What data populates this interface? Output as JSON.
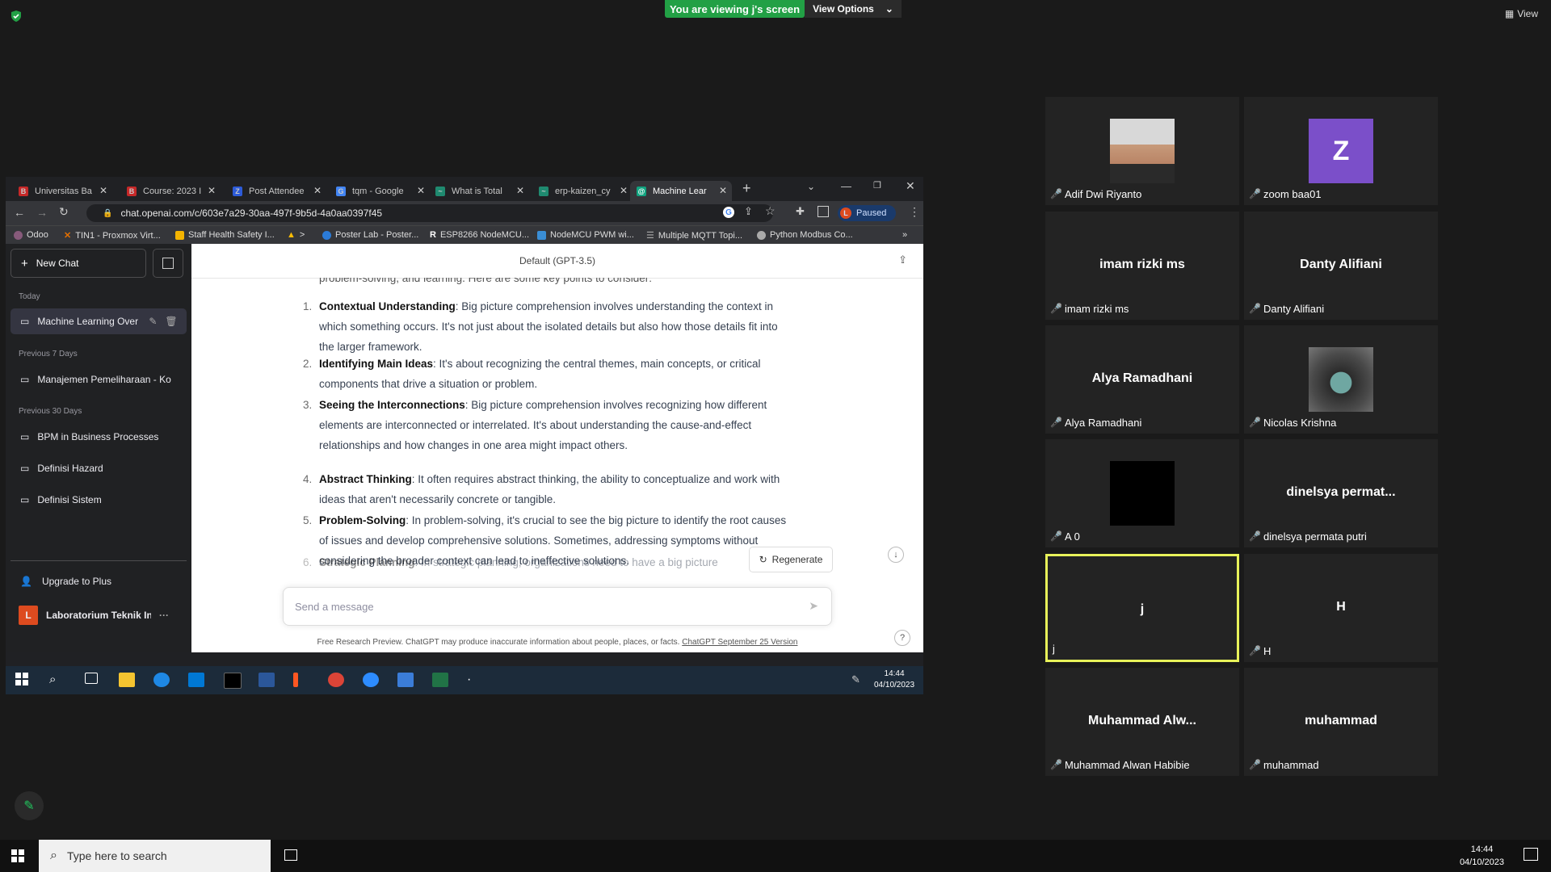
{
  "zoom": {
    "share_banner": "You are viewing j's screen",
    "view_options": "View Options",
    "view_label": "View"
  },
  "browser": {
    "tabs": [
      {
        "label": "Universitas Ba",
        "color": "#c62828",
        "icon": "B"
      },
      {
        "label": "Course: 2023 I",
        "color": "#c62828",
        "icon": "B"
      },
      {
        "label": "Post Attendee",
        "color": "#2d5bd8",
        "icon": "Z"
      },
      {
        "label": "tqm - Google",
        "color": "#4285f4",
        "icon": "G"
      },
      {
        "label": "What is Total",
        "color": "#1f8a70",
        "icon": "~"
      },
      {
        "label": "erp-kaizen_cy",
        "color": "#1f8a70",
        "icon": "~"
      },
      {
        "label": "Machine Lear",
        "color": "#10a37f",
        "icon": "@"
      }
    ],
    "url": "chat.openai.com/c/603e7a29-30aa-497f-9b5d-4a0aa0397f45",
    "profile_status": "Paused",
    "profile_initial": "L",
    "bookmarks": [
      "Odoo",
      "TIN1 - Proxmox Virt...",
      "Staff Health Safety I...",
      ">",
      "Poster Lab - Poster...",
      "ESP8266 NodeMCU...",
      "NodeMCU PWM wi...",
      "Multiple MQTT Topi...",
      "Python Modbus Co..."
    ]
  },
  "gpt": {
    "new_chat": "New Chat",
    "sections": {
      "today": "Today",
      "prev7": "Previous 7 Days",
      "prev30": "Previous 30 Days"
    },
    "history": {
      "today": [
        "Machine Learning Over"
      ],
      "prev7": [
        "Manajemen Pemeliharaan - Ko"
      ],
      "prev30": [
        "BPM in Business Processes",
        "Definisi Hazard",
        "Definisi Sistem"
      ]
    },
    "upgrade": "Upgrade to Plus",
    "user_name": "Laboratorium Teknik In",
    "user_initial": "L",
    "model": "Default (GPT-3.5)",
    "partial_top": "problem-solving, and learning. Here are some key points to consider:",
    "points": [
      {
        "n": "1.",
        "title": "Contextual Understanding",
        "text": ": Big picture comprehension involves understanding the context in which something occurs. It's not just about the isolated details but also how those details fit into the larger framework."
      },
      {
        "n": "2.",
        "title": "Identifying Main Ideas",
        "text": ": It's about recognizing the central themes, main concepts, or critical components that drive a situation or problem."
      },
      {
        "n": "3.",
        "title": "Seeing the Interconnections",
        "text": ": Big picture comprehension involves recognizing how different elements are interconnected or interrelated. It's about understanding the cause-and-effect relationships and how changes in one area might impact others."
      },
      {
        "n": "4.",
        "title": "Abstract Thinking",
        "text": ": It often requires abstract thinking, the ability to conceptualize and work with ideas that aren't necessarily concrete or tangible."
      },
      {
        "n": "5.",
        "title": "Problem-Solving",
        "text": ": In problem-solving, it's crucial to see the big picture to identify the root causes of issues and develop comprehensive solutions. Sometimes, addressing symptoms without considering the broader context can lead to ineffective solutions."
      },
      {
        "n": "6.",
        "title": "Strategic Planning",
        "text": ": In strategic planning, organizations need to have a big picture"
      }
    ],
    "regenerate": "Regenerate",
    "message_placeholder": "Send a message",
    "footer_text": "Free Research Preview. ChatGPT may produce inaccurate information about people, places, or facts.",
    "footer_link": "ChatGPT September 25 Version",
    "help": "?"
  },
  "shared_clock": {
    "time": "14:44",
    "date": "04/10/2023"
  },
  "participants": [
    {
      "name": "Adif Dwi Riyanto",
      "big": "",
      "muted": true,
      "pic": "photo"
    },
    {
      "name": "zoom baa01",
      "big": "",
      "muted": true,
      "pic": "Z"
    },
    {
      "name": "imam rizki ms",
      "big": "imam rizki ms",
      "muted": true,
      "pic": ""
    },
    {
      "name": "Danty Alifiani",
      "big": "Danty Alifiani",
      "muted": true,
      "pic": ""
    },
    {
      "name": "Alya Ramadhani",
      "big": "Alya Ramadhani",
      "muted": true,
      "pic": ""
    },
    {
      "name": "Nicolas Krishna",
      "big": "",
      "muted": true,
      "pic": "photo2"
    },
    {
      "name": "A 0",
      "big": "",
      "muted": true,
      "pic": "black"
    },
    {
      "name": "dinelsya permata putri",
      "big": "dinelsya permat...",
      "muted": true,
      "pic": ""
    },
    {
      "name": "j",
      "big": "j",
      "muted": false,
      "pic": "",
      "active": true
    },
    {
      "name": "H",
      "big": "H",
      "muted": true,
      "pic": ""
    },
    {
      "name": "Muhammad Alwan Habibie",
      "big": "Muhammad  Alw...",
      "muted": true,
      "pic": ""
    },
    {
      "name": "muhammad",
      "big": "muhammad",
      "muted": true,
      "pic": ""
    }
  ],
  "taskbar": {
    "search_placeholder": "Type here to search",
    "time": "14:44",
    "date": "04/10/2023"
  }
}
